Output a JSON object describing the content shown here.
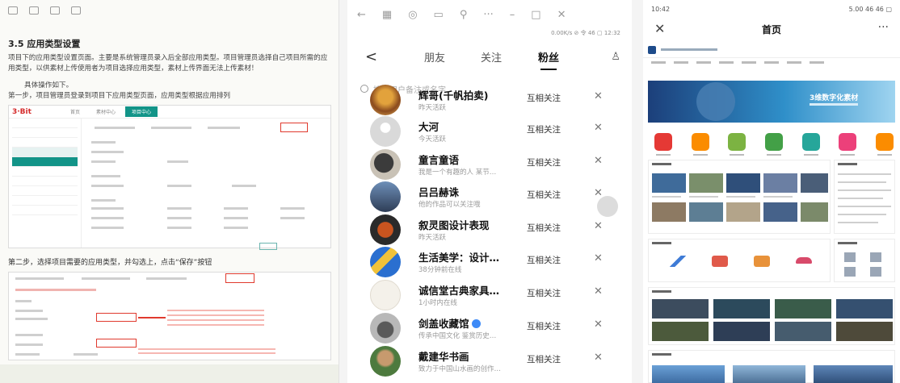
{
  "doc": {
    "heading": "3.5 应用类型设置",
    "para1": "项目下的应用类型设置页面。主要是系统管理员录入后全部应用类型。项目管理员选择自己项目所需的应用类型，以供素材上传使用者为项目选择应用类型，素材上传界面无法上传素材！",
    "para2": "具体操作如下。",
    "para3": "第一步，项目管理员登录到项目下应用类型页面，应用类型根据应用排列",
    "shot1_logo": "3·Bit",
    "shot1_tabs": [
      "首页",
      "素材中心",
      "项目中心"
    ],
    "para4": "第二步，选择项目需要的应用类型，并勾选上，点击“保存”按钮"
  },
  "wechat": {
    "status": "0.00K/s ⊘ 令 46 ▢ 12:32",
    "back": "<",
    "tabs": [
      "朋友",
      "关注",
      "粉丝"
    ],
    "active_tab": "粉丝",
    "search_placeholder": "搜索用户备注或名字",
    "follow_label": "互相关注",
    "close_glyph": "✕",
    "fans": [
      {
        "name": "辉哥(千帆拍卖)",
        "sub": "昨天活跃",
        "verified": false
      },
      {
        "name": "大河",
        "sub": "今天活跃",
        "verified": false
      },
      {
        "name": "童言童语",
        "sub": "我是一个有趣的人 某节…",
        "verified": false
      },
      {
        "name": "吕吕赫诛",
        "sub": "他的作品可以关注哦",
        "verified": false
      },
      {
        "name": "叙灵图设计表现",
        "sub": "昨天活跃",
        "verified": false
      },
      {
        "name": "生活美学：设计…",
        "sub": "38分钟前在线",
        "verified": false
      },
      {
        "name": "诚信堂古典家具…",
        "sub": "1小时内在线",
        "verified": false
      },
      {
        "name": "剑盖收藏馆",
        "sub": "传承中国文化 鉴赏历史…",
        "verified": true
      },
      {
        "name": "戴建华书画",
        "sub": "致力于中国山水画的创作…",
        "verified": false
      }
    ]
  },
  "site": {
    "status_time": "10:42",
    "status_right": "5.00 46 46 ▢",
    "close_glyph": "✕",
    "title": "首页",
    "more_glyph": "···",
    "banner_text": "3维数字化素材"
  }
}
